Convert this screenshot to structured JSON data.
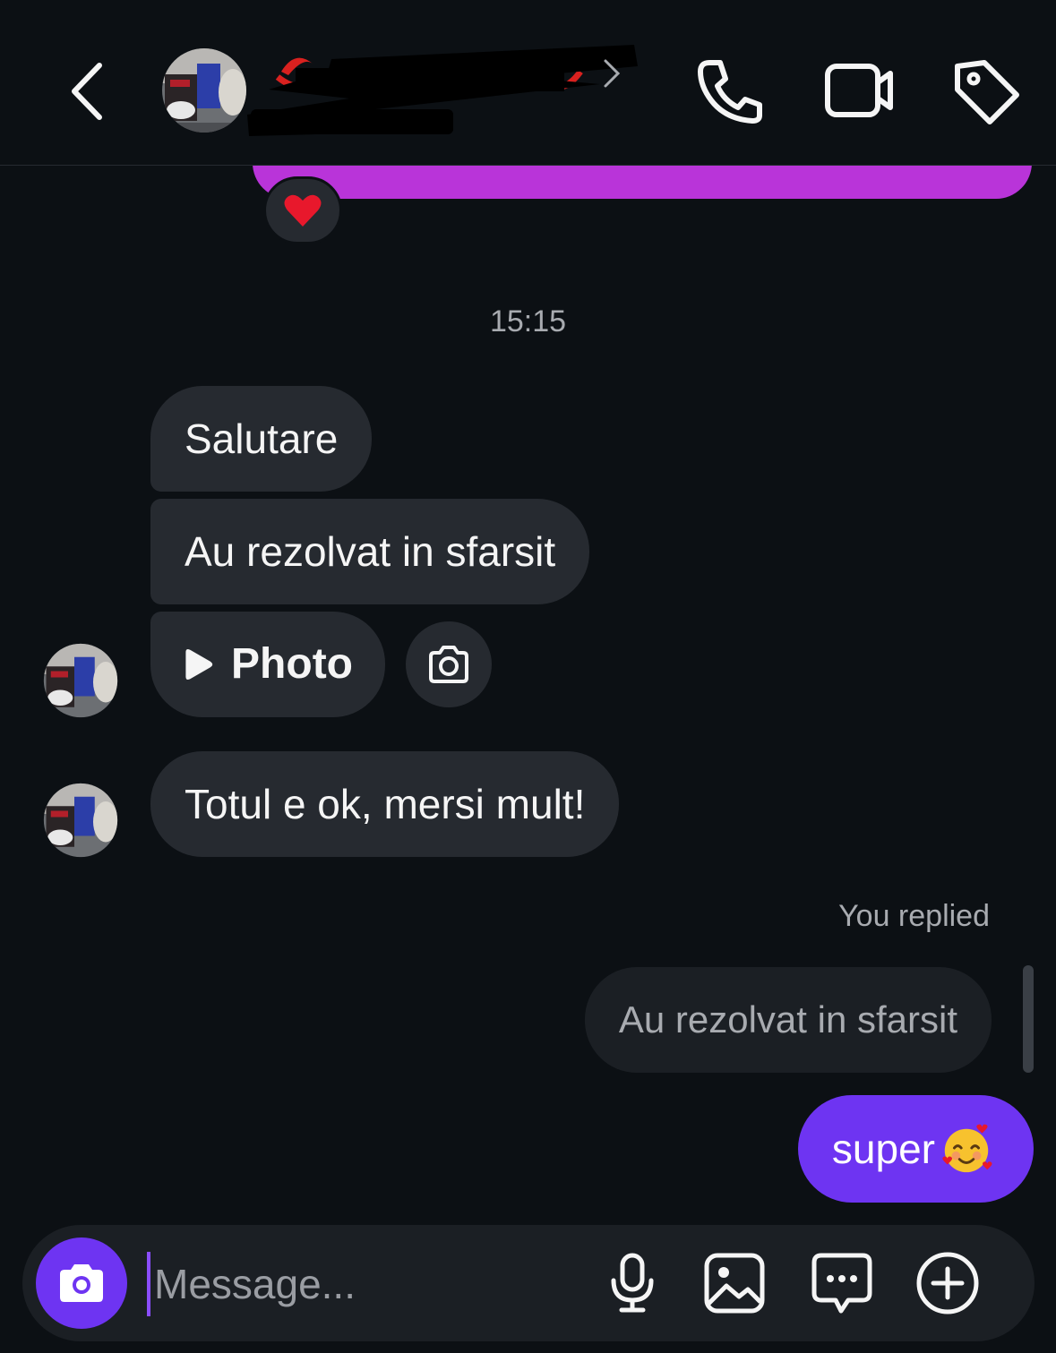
{
  "header": {
    "back_label": "",
    "chevron": "›"
  },
  "icons": {
    "back": "chevron-left-icon",
    "call": "phone-icon",
    "video": "video-camera-icon",
    "tag": "tag-icon",
    "heart": "heart-icon",
    "play": "play-icon",
    "camera": "camera-icon",
    "mic": "microphone-icon",
    "gallery": "image-icon",
    "sticker": "sticker-chat-icon",
    "plus": "plus-circle-icon"
  },
  "colors": {
    "background": "#0c1014",
    "incoming_bubble": "#262a30",
    "outgoing_bubble": "#6e34f2",
    "previous_bubble": "#b934d9"
  },
  "conversation": {
    "timestamp": "15:15",
    "incoming": [
      {
        "text": "Salutare"
      },
      {
        "text": "Au rezolvat in sfarsit"
      },
      {
        "text": "Photo"
      },
      {
        "text": "Totul e ok, mersi mult!"
      }
    ],
    "reply_context": "You replied",
    "quoted_message": "Au rezolvat in sfarsit",
    "outgoing": [
      {
        "text": "super"
      }
    ]
  },
  "composer": {
    "placeholder": "Message..."
  }
}
